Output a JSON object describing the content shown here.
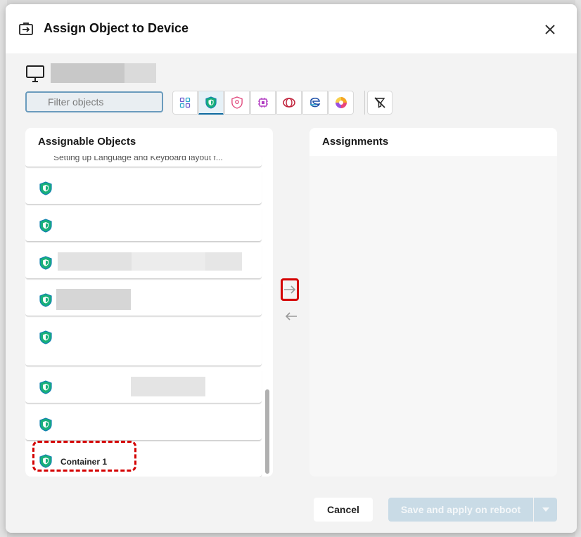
{
  "dialog": {
    "title": "Assign Object to Device",
    "icon": "assign-to-device-icon",
    "close_icon": "close-icon"
  },
  "device": {
    "icon": "monitor-icon"
  },
  "filter": {
    "placeholder": "Filter objects",
    "type_buttons": [
      {
        "name": "all-objects-icon",
        "active": false
      },
      {
        "name": "security-shield-icon",
        "active": true
      },
      {
        "name": "profile-shield-icon",
        "active": false
      },
      {
        "name": "firmware-chip-icon",
        "active": false
      },
      {
        "name": "citrix-icon",
        "active": false
      },
      {
        "name": "edge-browser-icon",
        "active": false
      },
      {
        "name": "color-wheel-icon",
        "active": false
      }
    ],
    "clear_filter_icon": "filter-clear-icon"
  },
  "assignable": {
    "title": "Assignable Objects",
    "cut_item_text": "Setting up Language and Keyboard layout f...",
    "items": [
      {
        "label": ""
      },
      {
        "label": ""
      },
      {
        "label": ""
      },
      {
        "label": ""
      },
      {
        "label": ""
      },
      {
        "label": ""
      },
      {
        "label": ""
      },
      {
        "label": "Container 1"
      }
    ]
  },
  "assignments": {
    "title": "Assignments"
  },
  "footer": {
    "cancel_label": "Cancel",
    "save_label": "Save and apply on reboot"
  },
  "colors": {
    "accent": "#0f6aa0",
    "highlight": "#d40000",
    "shield_green": "#19b07a",
    "disabled_button": "#c9dbe6"
  }
}
